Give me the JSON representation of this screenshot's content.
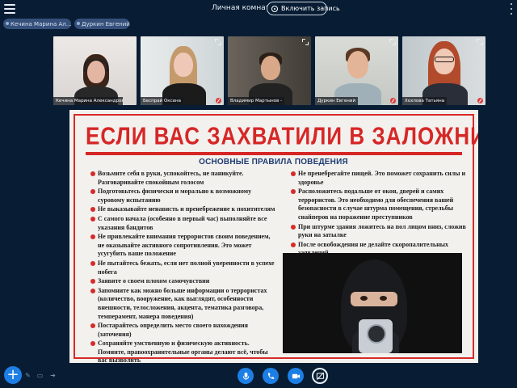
{
  "header": {
    "room_title": "Личная комната",
    "record_label": "Включить запись"
  },
  "participants_bar": [
    {
      "name": "Кечина Марина Ал..."
    },
    {
      "name": "Дуркин Евгений"
    }
  ],
  "video_tiles": [
    {
      "name": "Кечина Марина Александровна -",
      "muted": false,
      "bg": "#e8e5e4",
      "skin": "#e3b6a4",
      "hair": "#3a2419",
      "shirt": "#282828"
    },
    {
      "name": "Беспрай Оксана",
      "muted": true,
      "bg": "#dfe3e4",
      "skin": "#efc8b7",
      "hair": "#c49a6b",
      "shirt": "#1b1b1b"
    },
    {
      "name": "Владимир Мартынов -",
      "muted": false,
      "bg": "#55504a",
      "skin": "#d9a889",
      "hair": "#2b1f17",
      "shirt": "#222222"
    },
    {
      "name": "Дуркин Евгений",
      "muted": true,
      "bg": "#d3d5d0",
      "skin": "#e4b497",
      "hair": "#5a3a24",
      "shirt": "#9fb0b8"
    },
    {
      "name": "Хохлова Татьяна",
      "muted": true,
      "bg": "#c7cdd1",
      "skin": "#f0cab6",
      "hair": "#b24a2c",
      "shirt": "#2a2e38"
    }
  ],
  "poster": {
    "title": "ЕСЛИ ВАС ЗАХВАТИЛИ В ЗАЛОЖНИКИ",
    "subtitle": "ОСНОВНЫЕ ПРАВИЛА ПОВЕДЕНИЯ",
    "rules_left": [
      "Возьмите себя в руки, успокойтесь, не паникуйте. Разговаривайте спокойным голосом",
      "Подготовьтесь физически и морально к возможному суровому испытанию",
      "Не выказывайте ненависть и пренебрежение к похитителям",
      "С самого начала (особенно в первый час) выполняйте все указания бандитов",
      "Не привлекайте внимания террористов своим поведением, не оказывайте активного сопротивления. Это может усугубить ваше положение",
      "Не пытайтесь бежать, если нет полной уверенности в успехе побега",
      "Заявите о своем плохом самочувствии",
      "Запомните как можно больше информации о террористах (количество, вооружение, как выглядят, особенности внешности, телосложения, акцента, тематика разговора, темперамент, манера поведения)",
      "Постарайтесь определить место своего нахождения (заточения)",
      "Сохраняйте умственную и физическую активность. Помните, правоохранительные органы делают всё, чтобы вас вызволить"
    ],
    "rules_right": [
      "Не пренебрегайте пищей. Это поможет сохранить силы и здоровье",
      "Расположитесь подальше от окон, дверей и самих террористов. Это необходимо для обеспечения вашей безопасности в случае штурма помещения, стрельбы снайперов на поражение преступников",
      "При штурме здания ложитесь на пол лицом вниз, сложив руки на затылке",
      "После освобождения не делайте скоропалительных заявлений"
    ]
  },
  "colors": {
    "background": "#081d33",
    "accent": "#1d7fe5",
    "poster_red": "#d62726",
    "poster_blue": "#1e3c72",
    "muted_red": "#df3b3b"
  },
  "toolbar": {
    "plus_label": "+",
    "icons": [
      "mic-icon",
      "phone-icon",
      "camera-icon",
      "screen-share-off-icon"
    ]
  }
}
